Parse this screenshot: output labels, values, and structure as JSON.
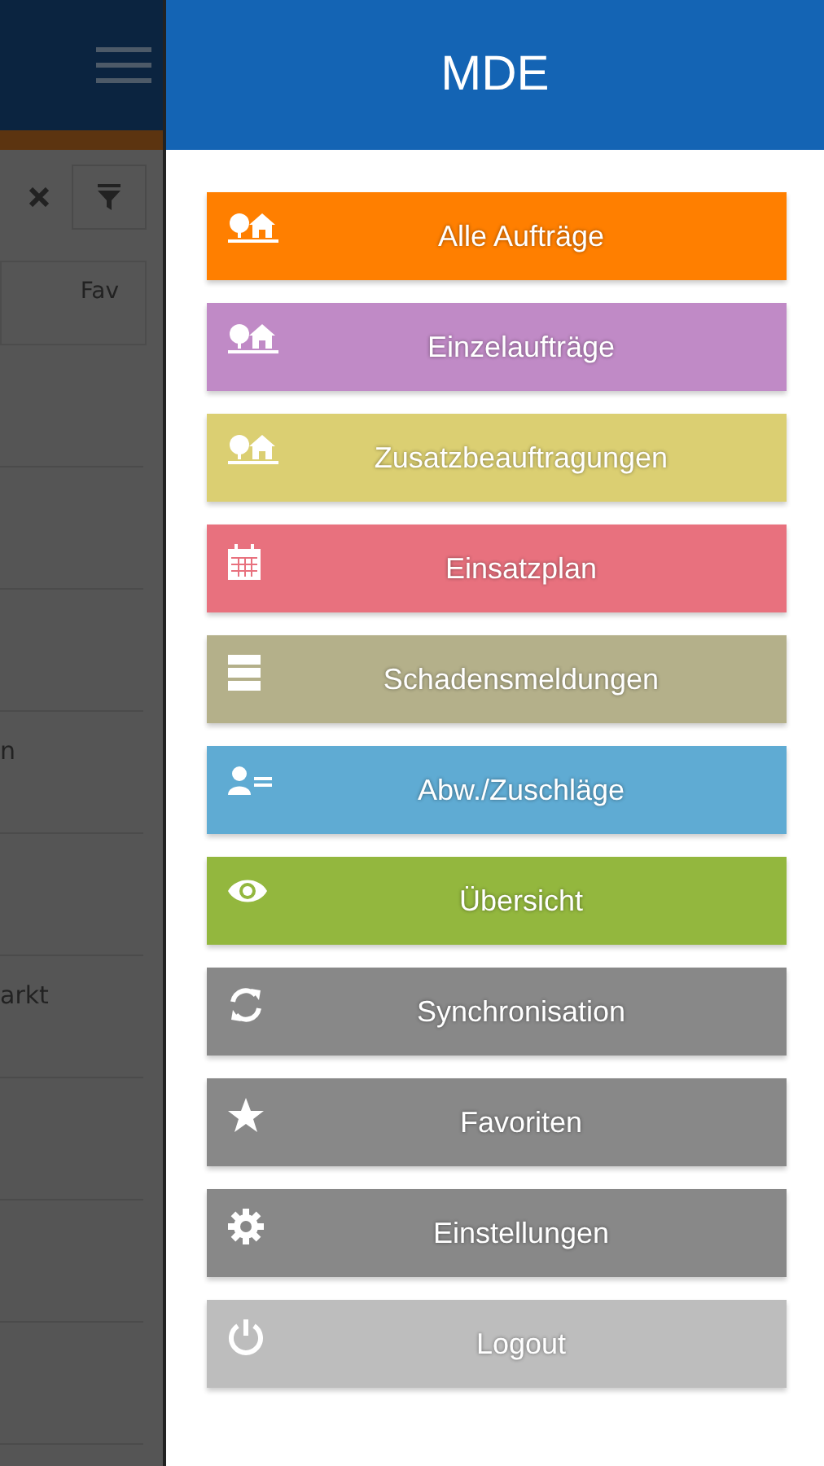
{
  "background": {
    "fav_label": "Fav",
    "rows": [
      {},
      {},
      {},
      {
        "label": "n"
      },
      {},
      {
        "label": "arkt"
      },
      {},
      {},
      {}
    ]
  },
  "drawer": {
    "title": "MDE",
    "items": [
      {
        "label": "Alle Aufträge",
        "kind": "orders",
        "color": "#ff7f00"
      },
      {
        "label": "Einzelaufträge",
        "kind": "orders",
        "color": "#c08ac6"
      },
      {
        "label": "Zusatzbeauftragungen",
        "kind": "orders",
        "color": "#dbcf72"
      },
      {
        "label": "Einsatzplan",
        "kind": "plan",
        "color": "#e8717e"
      },
      {
        "label": "Schadensmeldungen",
        "kind": "reports",
        "color": "#b4b08a"
      },
      {
        "label": "Abw./Zuschläge",
        "kind": "surcharges",
        "color": "#5fabd3"
      },
      {
        "label": "Übersicht",
        "kind": "overview",
        "color": "#93b73e"
      },
      {
        "label": "Synchronisation",
        "kind": "sync",
        "color": "#888888"
      },
      {
        "label": "Favoriten",
        "kind": "favorites",
        "color": "#888888"
      },
      {
        "label": "Einstellungen",
        "kind": "settings",
        "color": "#888888"
      },
      {
        "label": "Logout",
        "kind": "logout",
        "color": "#bdbdbd"
      }
    ]
  }
}
